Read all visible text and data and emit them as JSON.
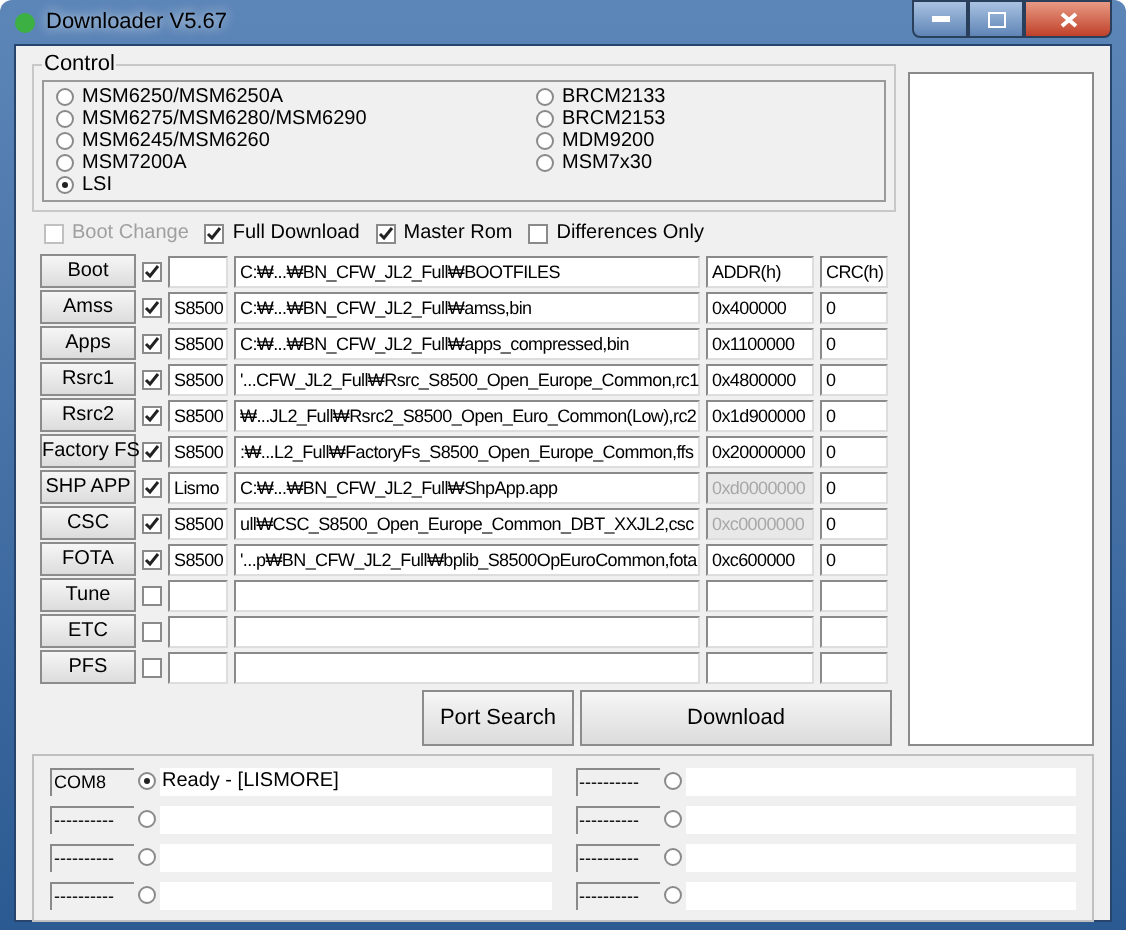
{
  "window": {
    "title": "Downloader V5.67"
  },
  "control": {
    "title": "Control",
    "options": [
      {
        "label": "MSM6250/MSM6250A",
        "selected": false
      },
      {
        "label": "MSM6275/MSM6280/MSM6290",
        "selected": false
      },
      {
        "label": "MSM6245/MSM6260",
        "selected": false
      },
      {
        "label": "MSM7200A",
        "selected": false
      },
      {
        "label": "LSI",
        "selected": true
      },
      {
        "label": "BRCM2133",
        "selected": false
      },
      {
        "label": "BRCM2153",
        "selected": false
      },
      {
        "label": "MDM9200",
        "selected": false
      },
      {
        "label": "MSM7x30",
        "selected": false
      }
    ]
  },
  "options": [
    {
      "label": "Boot Change",
      "checked": false,
      "disabled": true
    },
    {
      "label": "Full Download",
      "checked": true,
      "disabled": false
    },
    {
      "label": "Master Rom",
      "checked": true,
      "disabled": false
    },
    {
      "label": "Differences Only",
      "checked": false,
      "disabled": false
    }
  ],
  "files": [
    {
      "button": "Boot",
      "checked": true,
      "path": "C:₩...₩BN_CFW_JL2_Full₩BOOTFILES",
      "address": "ADDR(h)",
      "address_disabled": false,
      "crc": "CRC(h)"
    },
    {
      "button": "Amss",
      "checked": true,
      "model": "S8500",
      "path": "C:₩...₩BN_CFW_JL2_Full₩amss,bin",
      "address": "0x400000",
      "address_disabled": false,
      "crc": "0"
    },
    {
      "button": "Apps",
      "checked": true,
      "model": "S8500",
      "path": "C:₩...₩BN_CFW_JL2_Full₩apps_compressed,bin",
      "address": "0x1100000",
      "address_disabled": false,
      "crc": "0"
    },
    {
      "button": "Rsrc1",
      "checked": true,
      "model": "S8500",
      "path": "'...CFW_JL2_Full₩Rsrc_S8500_Open_Europe_Common,rc1",
      "address": "0x4800000",
      "address_disabled": false,
      "crc": "0"
    },
    {
      "button": "Rsrc2",
      "checked": true,
      "model": "S8500",
      "path": "₩...JL2_Full₩Rsrc2_S8500_Open_Euro_Common(Low),rc2",
      "address": "0x1d900000",
      "address_disabled": false,
      "crc": "0"
    },
    {
      "button": "Factory FS",
      "checked": true,
      "model": "S8500",
      "path": ":₩...L2_Full₩FactoryFs_S8500_Open_Europe_Common,ffs",
      "address": "0x20000000",
      "address_disabled": false,
      "crc": "0"
    },
    {
      "button": "SHP APP",
      "checked": true,
      "model": "Lismo",
      "path": "C:₩...₩BN_CFW_JL2_Full₩ShpApp.app",
      "address": "0xd0000000",
      "address_disabled": true,
      "crc": "0"
    },
    {
      "button": "CSC",
      "checked": true,
      "model": "S8500",
      "path": "ull₩CSC_S8500_Open_Europe_Common_DBT_XXJL2,csc",
      "address": "0xc0000000",
      "address_disabled": true,
      "crc": "0"
    },
    {
      "button": "FOTA",
      "checked": true,
      "model": "S8500",
      "path": "'...p₩BN_CFW_JL2_Full₩bplib_S8500OpEuroCommon,fota",
      "address": "0xc600000",
      "address_disabled": false,
      "crc": "0"
    },
    {
      "button": "Tune",
      "checked": false,
      "address_disabled": false
    },
    {
      "button": "ETC",
      "checked": false,
      "address_disabled": false
    },
    {
      "button": "PFS",
      "checked": false,
      "address_disabled": false
    }
  ],
  "buttons": [
    "Port Search",
    "Download"
  ],
  "ports": [
    {
      "port": "COM8",
      "selected": true,
      "status": "Ready - [LISMORE]"
    },
    {
      "port": "----------",
      "selected": false
    },
    {
      "port": "----------",
      "selected": false
    },
    {
      "port": "----------",
      "selected": false
    },
    {
      "port": "----------",
      "selected": false
    },
    {
      "port": "----------",
      "selected": false
    },
    {
      "port": "----------",
      "selected": false
    },
    {
      "port": "----------",
      "selected": false
    }
  ]
}
